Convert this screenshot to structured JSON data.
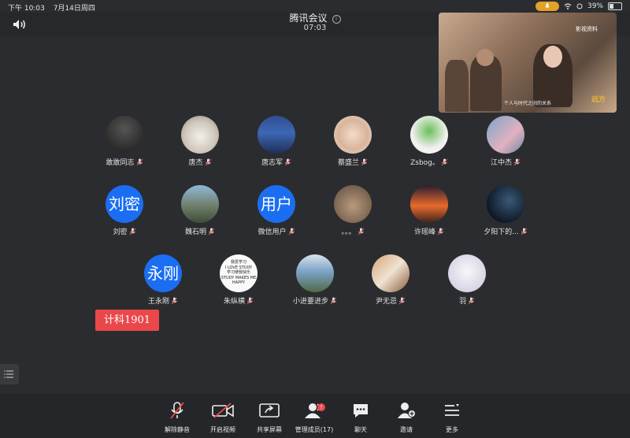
{
  "status": {
    "time": "下午 10:03",
    "date": "7月14日周四",
    "battery": "39%",
    "battery_level": 0.39
  },
  "meeting": {
    "title": "腾讯会议",
    "timer": "07:03"
  },
  "shared_video": {
    "tag": "影视资料",
    "subtitle": "个人与时代之间的关系",
    "logo": "远方"
  },
  "participants": [
    {
      "name": "敢敢同志",
      "avatar": ""
    },
    {
      "name": "唐杰",
      "avatar": ""
    },
    {
      "name": "唐志军",
      "avatar": ""
    },
    {
      "name": "蔡盛兰",
      "avatar": ""
    },
    {
      "name": "Zsbog。",
      "avatar": ""
    },
    {
      "name": "江中杰",
      "avatar": ""
    },
    {
      "name": "刘密",
      "avatar": "刘密"
    },
    {
      "name": "魏石明",
      "avatar": ""
    },
    {
      "name": "微信用户",
      "avatar": "用户"
    },
    {
      "name": "。。。",
      "avatar": ""
    },
    {
      "name": "许瑶峰",
      "avatar": ""
    },
    {
      "name": "夕阳下的...",
      "avatar": ""
    },
    {
      "name": "王永刚",
      "avatar": "永刚"
    },
    {
      "name": "朱纵横",
      "avatar": ""
    },
    {
      "name": "小进要进步",
      "avatar": ""
    },
    {
      "name": "尹无忌",
      "avatar": ""
    },
    {
      "name": "羽",
      "avatar": ""
    }
  ],
  "avatar_poster_text": [
    "我爱学习",
    "I LOVE STUDY",
    "学习使我快乐",
    "STUDY MAKES ME",
    "HAPPY"
  ],
  "sticker": "计科1901",
  "toolbar": [
    {
      "label": "解除静音",
      "icon": "mic-muted-icon"
    },
    {
      "label": "开启视频",
      "icon": "video-off-icon"
    },
    {
      "label": "共享屏幕",
      "icon": "share-screen-icon"
    },
    {
      "label": "管理成员(17)",
      "icon": "members-icon",
      "badge": "!"
    },
    {
      "label": "聊天",
      "icon": "chat-icon"
    },
    {
      "label": "邀请",
      "icon": "invite-icon"
    },
    {
      "label": "更多",
      "icon": "more-icon"
    }
  ],
  "colors": {
    "accent": "#1b6ef2",
    "mic_pill": "#e4a12a",
    "sticker": "#e9474a"
  }
}
